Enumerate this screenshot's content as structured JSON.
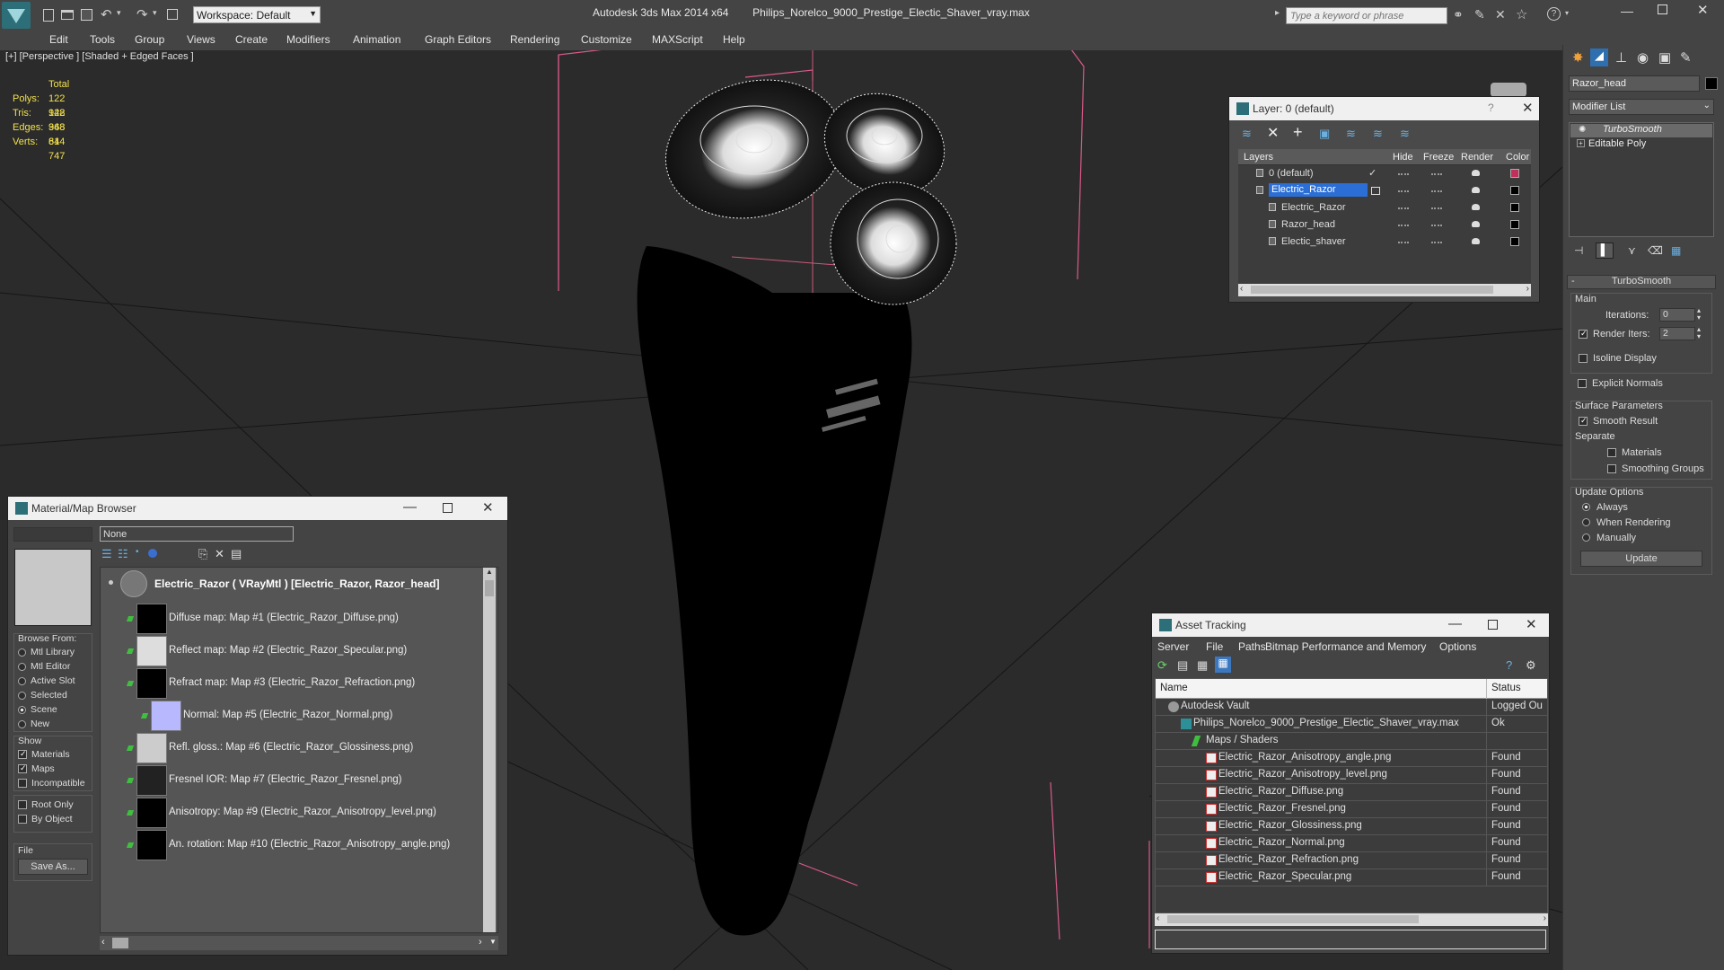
{
  "app": {
    "title": "Autodesk 3ds Max  2014 x64",
    "file": "Philips_Norelco_9000_Prestige_Electic_Shaver_vray.max",
    "workspace": "Workspace: Default",
    "search_placeholder": "Type a keyword or phrase"
  },
  "menu": [
    "Edit",
    "Tools",
    "Group",
    "Views",
    "Create",
    "Modifiers",
    "Animation",
    "Graph Editors",
    "Rendering",
    "Customize",
    "MAXScript",
    "Help"
  ],
  "viewport": {
    "label": "[+] [Perspective ] [Shaded + Edged Faces ]",
    "stats": {
      "header": "Total",
      "rows": [
        {
          "k": "Polys:",
          "v": "122 948"
        },
        {
          "k": "Tris:",
          "v": "122 948"
        },
        {
          "k": "Edges:",
          "v": "368 844"
        },
        {
          "k": "Verts:",
          "v": "61 747"
        }
      ]
    },
    "colors": {
      "bg": "#2b2b2b",
      "selection": "#d85a8a",
      "grid": "#1a1a1a"
    }
  },
  "layers": {
    "title": "Layer: 0 (default)",
    "columns": [
      "Layers",
      "Hide",
      "Freeze",
      "Render",
      "Color"
    ],
    "rows": [
      {
        "name": "0 (default)",
        "indent": 1,
        "check": "✓",
        "color": "#c0305a",
        "selected": false
      },
      {
        "name": "Electric_Razor",
        "indent": 1,
        "check": "",
        "color": "#000000",
        "selected": true
      },
      {
        "name": "Electric_Razor",
        "indent": 2,
        "check": "",
        "color": "#000000",
        "selected": false
      },
      {
        "name": "Razor_head",
        "indent": 2,
        "check": "",
        "color": "#000000",
        "selected": false
      },
      {
        "name": "Electic_shaver",
        "indent": 2,
        "check": "",
        "color": "#000000",
        "selected": false
      }
    ]
  },
  "material_browser": {
    "title": "Material/Map Browser",
    "search_value": "None",
    "root": "Electric_Razor  ( VRayMtl )  [Electric_Razor, Razor_head]",
    "maps": [
      {
        "label": "Diffuse map: Map #1 (Electric_Razor_Diffuse.png)",
        "indent": 0
      },
      {
        "label": "Reflect map: Map #2 (Electric_Razor_Specular.png)",
        "indent": 0
      },
      {
        "label": "Refract map: Map #3 (Electric_Razor_Refraction.png)",
        "indent": 0
      },
      {
        "label": "Normal: Map #5 (Electric_Razor_Normal.png)",
        "indent": 1
      },
      {
        "label": "Refl. gloss.: Map #6 (Electric_Razor_Glossiness.png)",
        "indent": 0
      },
      {
        "label": "Fresnel IOR: Map #7 (Electric_Razor_Fresnel.png)",
        "indent": 0
      },
      {
        "label": "Anisotropy: Map #9 (Electric_Razor_Anisotropy_level.png)",
        "indent": 0
      },
      {
        "label": "An. rotation: Map #10 (Electric_Razor_Anisotropy_angle.png)",
        "indent": 0
      }
    ],
    "browse_from": {
      "label": "Browse From:",
      "options": [
        {
          "label": "Mtl Library",
          "on": false
        },
        {
          "label": "Mtl Editor",
          "on": false
        },
        {
          "label": "Active Slot",
          "on": false
        },
        {
          "label": "Selected",
          "on": false
        },
        {
          "label": "Scene",
          "on": true
        },
        {
          "label": "New",
          "on": false
        }
      ]
    },
    "show": {
      "label": "Show",
      "options": [
        {
          "label": "Materials",
          "on": true
        },
        {
          "label": "Maps",
          "on": true
        },
        {
          "label": "Incompatible",
          "on": false
        }
      ]
    },
    "filters": [
      {
        "label": "Root Only",
        "on": false
      },
      {
        "label": "By Object",
        "on": false
      }
    ],
    "file_label": "File",
    "save_as": "Save As..."
  },
  "asset_tracking": {
    "title": "Asset Tracking",
    "menu": [
      "Server",
      "File",
      "Paths",
      "Bitmap Performance and Memory",
      "Options"
    ],
    "columns": [
      "Name",
      "Status"
    ],
    "rows": [
      {
        "name": "Autodesk Vault",
        "status": "Logged Ou",
        "indent": 1,
        "icon": "vault"
      },
      {
        "name": "Philips_Norelco_9000_Prestige_Electic_Shaver_vray.max",
        "status": "Ok",
        "indent": 2,
        "icon": "max"
      },
      {
        "name": "Maps / Shaders",
        "status": "",
        "indent": 3,
        "icon": "folder"
      },
      {
        "name": "Electric_Razor_Anisotropy_angle.png",
        "status": "Found",
        "indent": 4,
        "icon": "png"
      },
      {
        "name": "Electric_Razor_Anisotropy_level.png",
        "status": "Found",
        "indent": 4,
        "icon": "png"
      },
      {
        "name": "Electric_Razor_Diffuse.png",
        "status": "Found",
        "indent": 4,
        "icon": "png"
      },
      {
        "name": "Electric_Razor_Fresnel.png",
        "status": "Found",
        "indent": 4,
        "icon": "png"
      },
      {
        "name": "Electric_Razor_Glossiness.png",
        "status": "Found",
        "indent": 4,
        "icon": "png"
      },
      {
        "name": "Electric_Razor_Normal.png",
        "status": "Found",
        "indent": 4,
        "icon": "png"
      },
      {
        "name": "Electric_Razor_Refraction.png",
        "status": "Found",
        "indent": 4,
        "icon": "png"
      },
      {
        "name": "Electric_Razor_Specular.png",
        "status": "Found",
        "indent": 4,
        "icon": "png"
      }
    ]
  },
  "command_panel": {
    "object_name": "Razor_head",
    "modifier_list": "Modifier List",
    "stack": [
      "TurboSmooth",
      "Editable Poly"
    ],
    "rollout_title": "TurboSmooth",
    "main_label": "Main",
    "iterations_label": "Iterations:",
    "iterations_value": "0",
    "render_iters_label": "Render Iters:",
    "render_iters_value": "2",
    "render_iters_on": true,
    "isoline": "Isoline Display",
    "explicit_normals": "Explicit Normals",
    "surface_params": "Surface Parameters",
    "smooth_result": "Smooth Result",
    "separate": "Separate",
    "materials": "Materials",
    "smoothing_groups": "Smoothing Groups",
    "update_options": "Update Options",
    "update_always": "Always",
    "update_rendering": "When Rendering",
    "update_manually": "Manually",
    "update_button": "Update"
  }
}
